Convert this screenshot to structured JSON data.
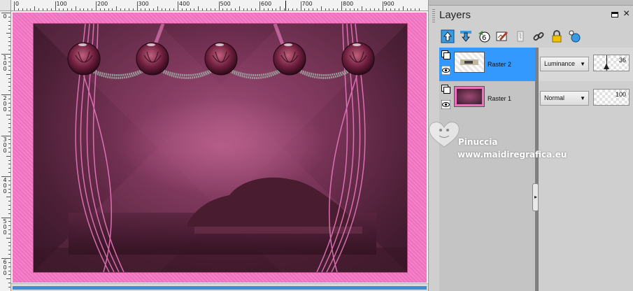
{
  "rulers": {
    "top_labels": [
      "0",
      "100",
      "200",
      "300",
      "400",
      "500",
      "600",
      "700",
      "800",
      "900"
    ],
    "left_labels": [
      "0",
      "1\n0\n0",
      "2\n0\n0",
      "3\n0\n0",
      "4\n0\n0",
      "5\n0\n0",
      "6\n0\n0"
    ]
  },
  "panel": {
    "title": "Layers"
  },
  "toolbar": {
    "icons": [
      "layer-up-icon",
      "layer-down-icon",
      "new-group-icon",
      "mask-icon",
      "adjustment-icon",
      "link-icon",
      "lock-icon",
      "settings-icon"
    ]
  },
  "layers": [
    {
      "name": "Raster 2",
      "blend_mode": "Luminance",
      "opacity": "36",
      "selected": true
    },
    {
      "name": "Raster 1",
      "blend_mode": "Normal",
      "opacity": "100",
      "selected": false
    }
  ],
  "watermark": {
    "name": "Pinuccia",
    "url": "www.maidiregrafica.eu"
  },
  "colors": {
    "selection": "#3399ff",
    "frame_pink": "#ef6fbf",
    "image_magenta": "#7a3458"
  }
}
